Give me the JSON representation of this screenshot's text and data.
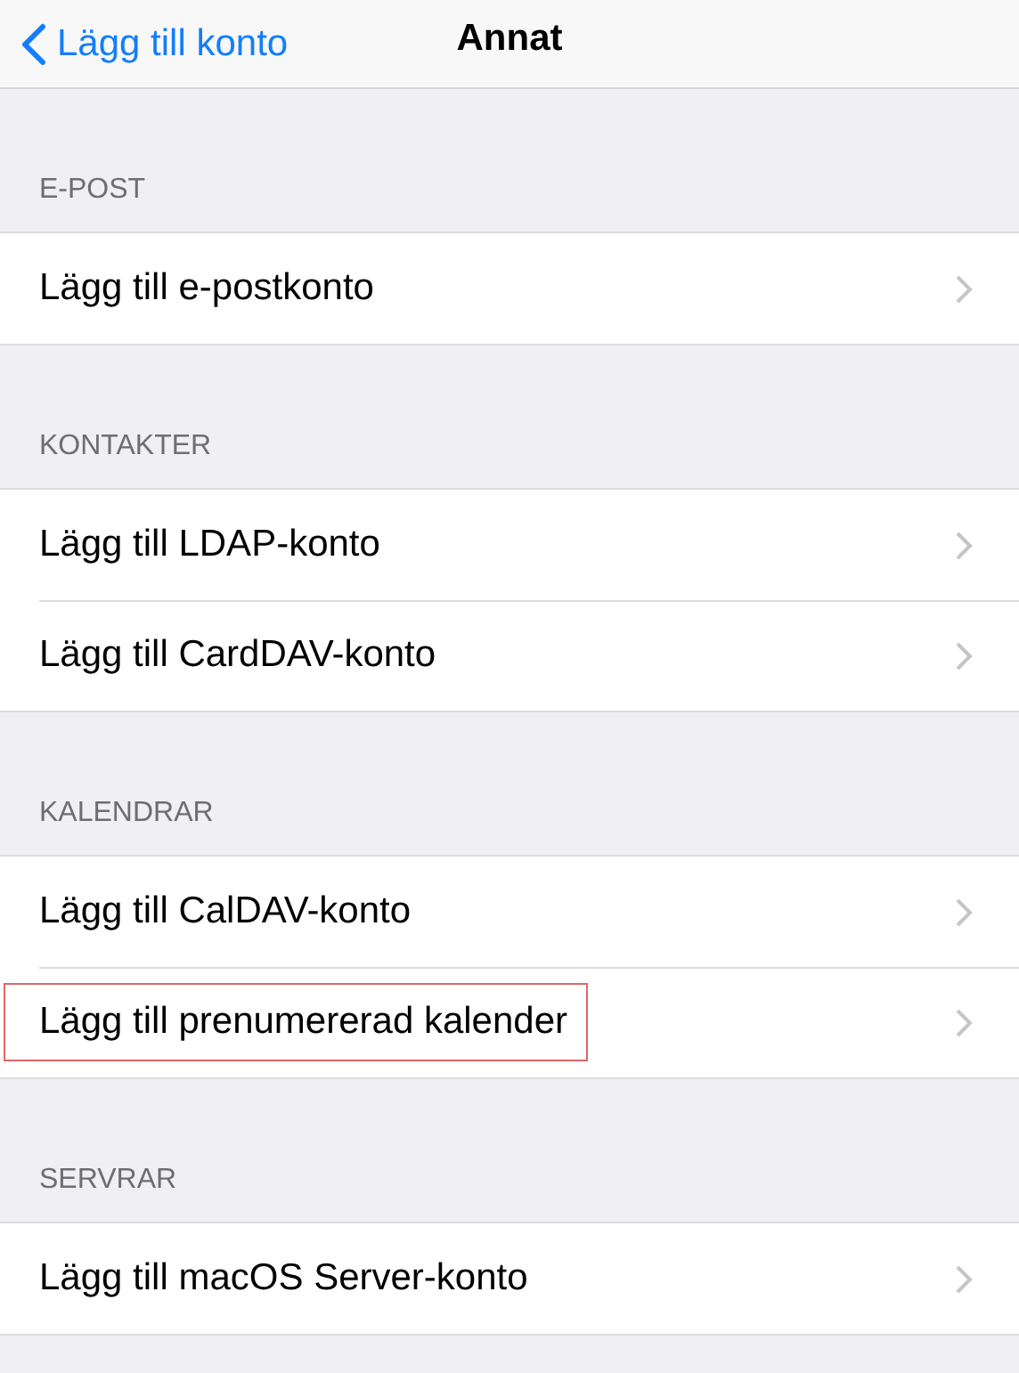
{
  "nav": {
    "back_label": "Lägg till konto",
    "title": "Annat"
  },
  "sections": [
    {
      "header": "E-POST",
      "rows": [
        {
          "label": "Lägg till e-postkonto",
          "highlighted": false
        }
      ]
    },
    {
      "header": "KONTAKTER",
      "rows": [
        {
          "label": "Lägg till LDAP-konto",
          "highlighted": false
        },
        {
          "label": "Lägg till CardDAV-konto",
          "highlighted": false
        }
      ]
    },
    {
      "header": "KALENDRAR",
      "rows": [
        {
          "label": "Lägg till CalDAV-konto",
          "highlighted": false
        },
        {
          "label": "Lägg till prenumererad kalender",
          "highlighted": true
        }
      ]
    },
    {
      "header": "SERVRAR",
      "rows": [
        {
          "label": "Lägg till macOS Server-konto",
          "highlighted": false
        }
      ]
    }
  ]
}
